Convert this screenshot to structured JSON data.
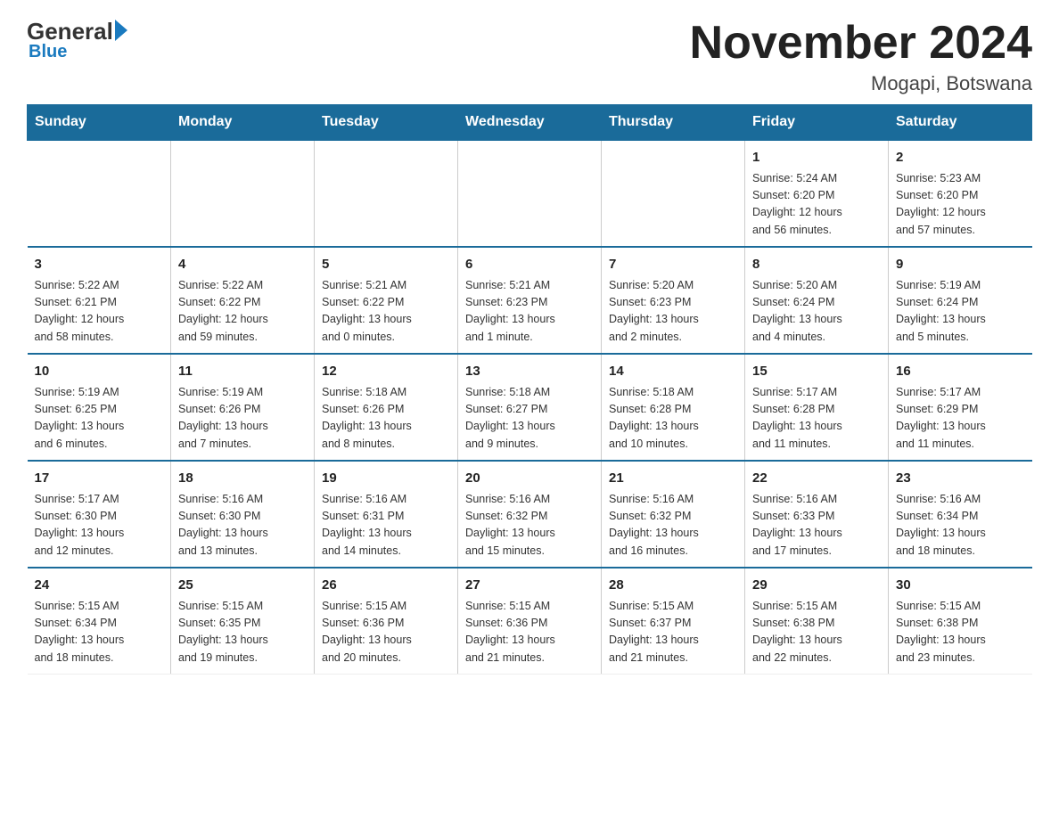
{
  "logo": {
    "general": "General",
    "blue": "Blue",
    "tagline": "Blue"
  },
  "header": {
    "title": "November 2024",
    "location": "Mogapi, Botswana"
  },
  "weekdays": [
    "Sunday",
    "Monday",
    "Tuesday",
    "Wednesday",
    "Thursday",
    "Friday",
    "Saturday"
  ],
  "weeks": [
    [
      {
        "day": "",
        "info": ""
      },
      {
        "day": "",
        "info": ""
      },
      {
        "day": "",
        "info": ""
      },
      {
        "day": "",
        "info": ""
      },
      {
        "day": "",
        "info": ""
      },
      {
        "day": "1",
        "info": "Sunrise: 5:24 AM\nSunset: 6:20 PM\nDaylight: 12 hours\nand 56 minutes."
      },
      {
        "day": "2",
        "info": "Sunrise: 5:23 AM\nSunset: 6:20 PM\nDaylight: 12 hours\nand 57 minutes."
      }
    ],
    [
      {
        "day": "3",
        "info": "Sunrise: 5:22 AM\nSunset: 6:21 PM\nDaylight: 12 hours\nand 58 minutes."
      },
      {
        "day": "4",
        "info": "Sunrise: 5:22 AM\nSunset: 6:22 PM\nDaylight: 12 hours\nand 59 minutes."
      },
      {
        "day": "5",
        "info": "Sunrise: 5:21 AM\nSunset: 6:22 PM\nDaylight: 13 hours\nand 0 minutes."
      },
      {
        "day": "6",
        "info": "Sunrise: 5:21 AM\nSunset: 6:23 PM\nDaylight: 13 hours\nand 1 minute."
      },
      {
        "day": "7",
        "info": "Sunrise: 5:20 AM\nSunset: 6:23 PM\nDaylight: 13 hours\nand 2 minutes."
      },
      {
        "day": "8",
        "info": "Sunrise: 5:20 AM\nSunset: 6:24 PM\nDaylight: 13 hours\nand 4 minutes."
      },
      {
        "day": "9",
        "info": "Sunrise: 5:19 AM\nSunset: 6:24 PM\nDaylight: 13 hours\nand 5 minutes."
      }
    ],
    [
      {
        "day": "10",
        "info": "Sunrise: 5:19 AM\nSunset: 6:25 PM\nDaylight: 13 hours\nand 6 minutes."
      },
      {
        "day": "11",
        "info": "Sunrise: 5:19 AM\nSunset: 6:26 PM\nDaylight: 13 hours\nand 7 minutes."
      },
      {
        "day": "12",
        "info": "Sunrise: 5:18 AM\nSunset: 6:26 PM\nDaylight: 13 hours\nand 8 minutes."
      },
      {
        "day": "13",
        "info": "Sunrise: 5:18 AM\nSunset: 6:27 PM\nDaylight: 13 hours\nand 9 minutes."
      },
      {
        "day": "14",
        "info": "Sunrise: 5:18 AM\nSunset: 6:28 PM\nDaylight: 13 hours\nand 10 minutes."
      },
      {
        "day": "15",
        "info": "Sunrise: 5:17 AM\nSunset: 6:28 PM\nDaylight: 13 hours\nand 11 minutes."
      },
      {
        "day": "16",
        "info": "Sunrise: 5:17 AM\nSunset: 6:29 PM\nDaylight: 13 hours\nand 11 minutes."
      }
    ],
    [
      {
        "day": "17",
        "info": "Sunrise: 5:17 AM\nSunset: 6:30 PM\nDaylight: 13 hours\nand 12 minutes."
      },
      {
        "day": "18",
        "info": "Sunrise: 5:16 AM\nSunset: 6:30 PM\nDaylight: 13 hours\nand 13 minutes."
      },
      {
        "day": "19",
        "info": "Sunrise: 5:16 AM\nSunset: 6:31 PM\nDaylight: 13 hours\nand 14 minutes."
      },
      {
        "day": "20",
        "info": "Sunrise: 5:16 AM\nSunset: 6:32 PM\nDaylight: 13 hours\nand 15 minutes."
      },
      {
        "day": "21",
        "info": "Sunrise: 5:16 AM\nSunset: 6:32 PM\nDaylight: 13 hours\nand 16 minutes."
      },
      {
        "day": "22",
        "info": "Sunrise: 5:16 AM\nSunset: 6:33 PM\nDaylight: 13 hours\nand 17 minutes."
      },
      {
        "day": "23",
        "info": "Sunrise: 5:16 AM\nSunset: 6:34 PM\nDaylight: 13 hours\nand 18 minutes."
      }
    ],
    [
      {
        "day": "24",
        "info": "Sunrise: 5:15 AM\nSunset: 6:34 PM\nDaylight: 13 hours\nand 18 minutes."
      },
      {
        "day": "25",
        "info": "Sunrise: 5:15 AM\nSunset: 6:35 PM\nDaylight: 13 hours\nand 19 minutes."
      },
      {
        "day": "26",
        "info": "Sunrise: 5:15 AM\nSunset: 6:36 PM\nDaylight: 13 hours\nand 20 minutes."
      },
      {
        "day": "27",
        "info": "Sunrise: 5:15 AM\nSunset: 6:36 PM\nDaylight: 13 hours\nand 21 minutes."
      },
      {
        "day": "28",
        "info": "Sunrise: 5:15 AM\nSunset: 6:37 PM\nDaylight: 13 hours\nand 21 minutes."
      },
      {
        "day": "29",
        "info": "Sunrise: 5:15 AM\nSunset: 6:38 PM\nDaylight: 13 hours\nand 22 minutes."
      },
      {
        "day": "30",
        "info": "Sunrise: 5:15 AM\nSunset: 6:38 PM\nDaylight: 13 hours\nand 23 minutes."
      }
    ]
  ]
}
